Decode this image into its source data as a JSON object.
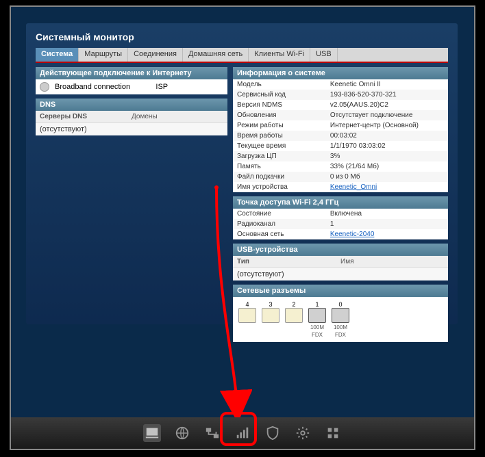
{
  "page_title": "Системный монитор",
  "tabs": [
    "Система",
    "Маршруты",
    "Соединения",
    "Домашняя сеть",
    "Клиенты Wi-Fi",
    "USB"
  ],
  "conn_panel": {
    "title": "Действующее подключение к Интернету",
    "name": "Broadband connection",
    "provider": "ISP"
  },
  "dns_panel": {
    "title": "DNS",
    "h1": "Серверы DNS",
    "h2": "Домены",
    "empty": "(отсутствуют)"
  },
  "sysinfo": {
    "title": "Информация о системе",
    "rows": [
      {
        "k": "Модель",
        "v": "Keenetic Omni II"
      },
      {
        "k": "Сервисный код",
        "v": "193-836-520-370-321"
      },
      {
        "k": "Версия NDMS",
        "v": "v2.05(AAUS.20)C2"
      },
      {
        "k": "Обновления",
        "v": "Отсутствует подключение"
      },
      {
        "k": "Режим работы",
        "v": "Интернет-центр (Основной)"
      },
      {
        "k": "Время работы",
        "v": "00:03:02"
      },
      {
        "k": "Текущее время",
        "v": "1/1/1970 03:03:02"
      },
      {
        "k": "Загрузка ЦП",
        "v": "3%"
      },
      {
        "k": "Память",
        "v": "33% (21/64 Мб)"
      },
      {
        "k": "Файл подкачки",
        "v": "0 из 0 Мб"
      },
      {
        "k": "Имя устройства",
        "v": "Keenetic_Omni",
        "link": true
      }
    ]
  },
  "wifi": {
    "title": "Точка доступа Wi-Fi 2,4 ГГц",
    "rows": [
      {
        "k": "Состояние",
        "v": "Включена"
      },
      {
        "k": "Радиоканал",
        "v": "1"
      },
      {
        "k": "Основная сеть",
        "v": "Keenetic-2040",
        "link": true
      }
    ]
  },
  "usb": {
    "title": "USB-устройства",
    "h1": "Тип",
    "h2": "Имя",
    "empty": "(отсутствуют)"
  },
  "ports_panel": {
    "title": "Сетевые разъемы",
    "ports": [
      {
        "num": "4",
        "active": false
      },
      {
        "num": "3",
        "active": false
      },
      {
        "num": "2",
        "active": false
      },
      {
        "num": "1",
        "active": true,
        "speed": "100M",
        "duplex": "FDX"
      },
      {
        "num": "0",
        "active": true,
        "speed": "100M",
        "duplex": "FDX"
      }
    ]
  },
  "taskbar_icons": [
    "monitor",
    "globe",
    "network",
    "wifi",
    "shield",
    "gear",
    "apps"
  ]
}
